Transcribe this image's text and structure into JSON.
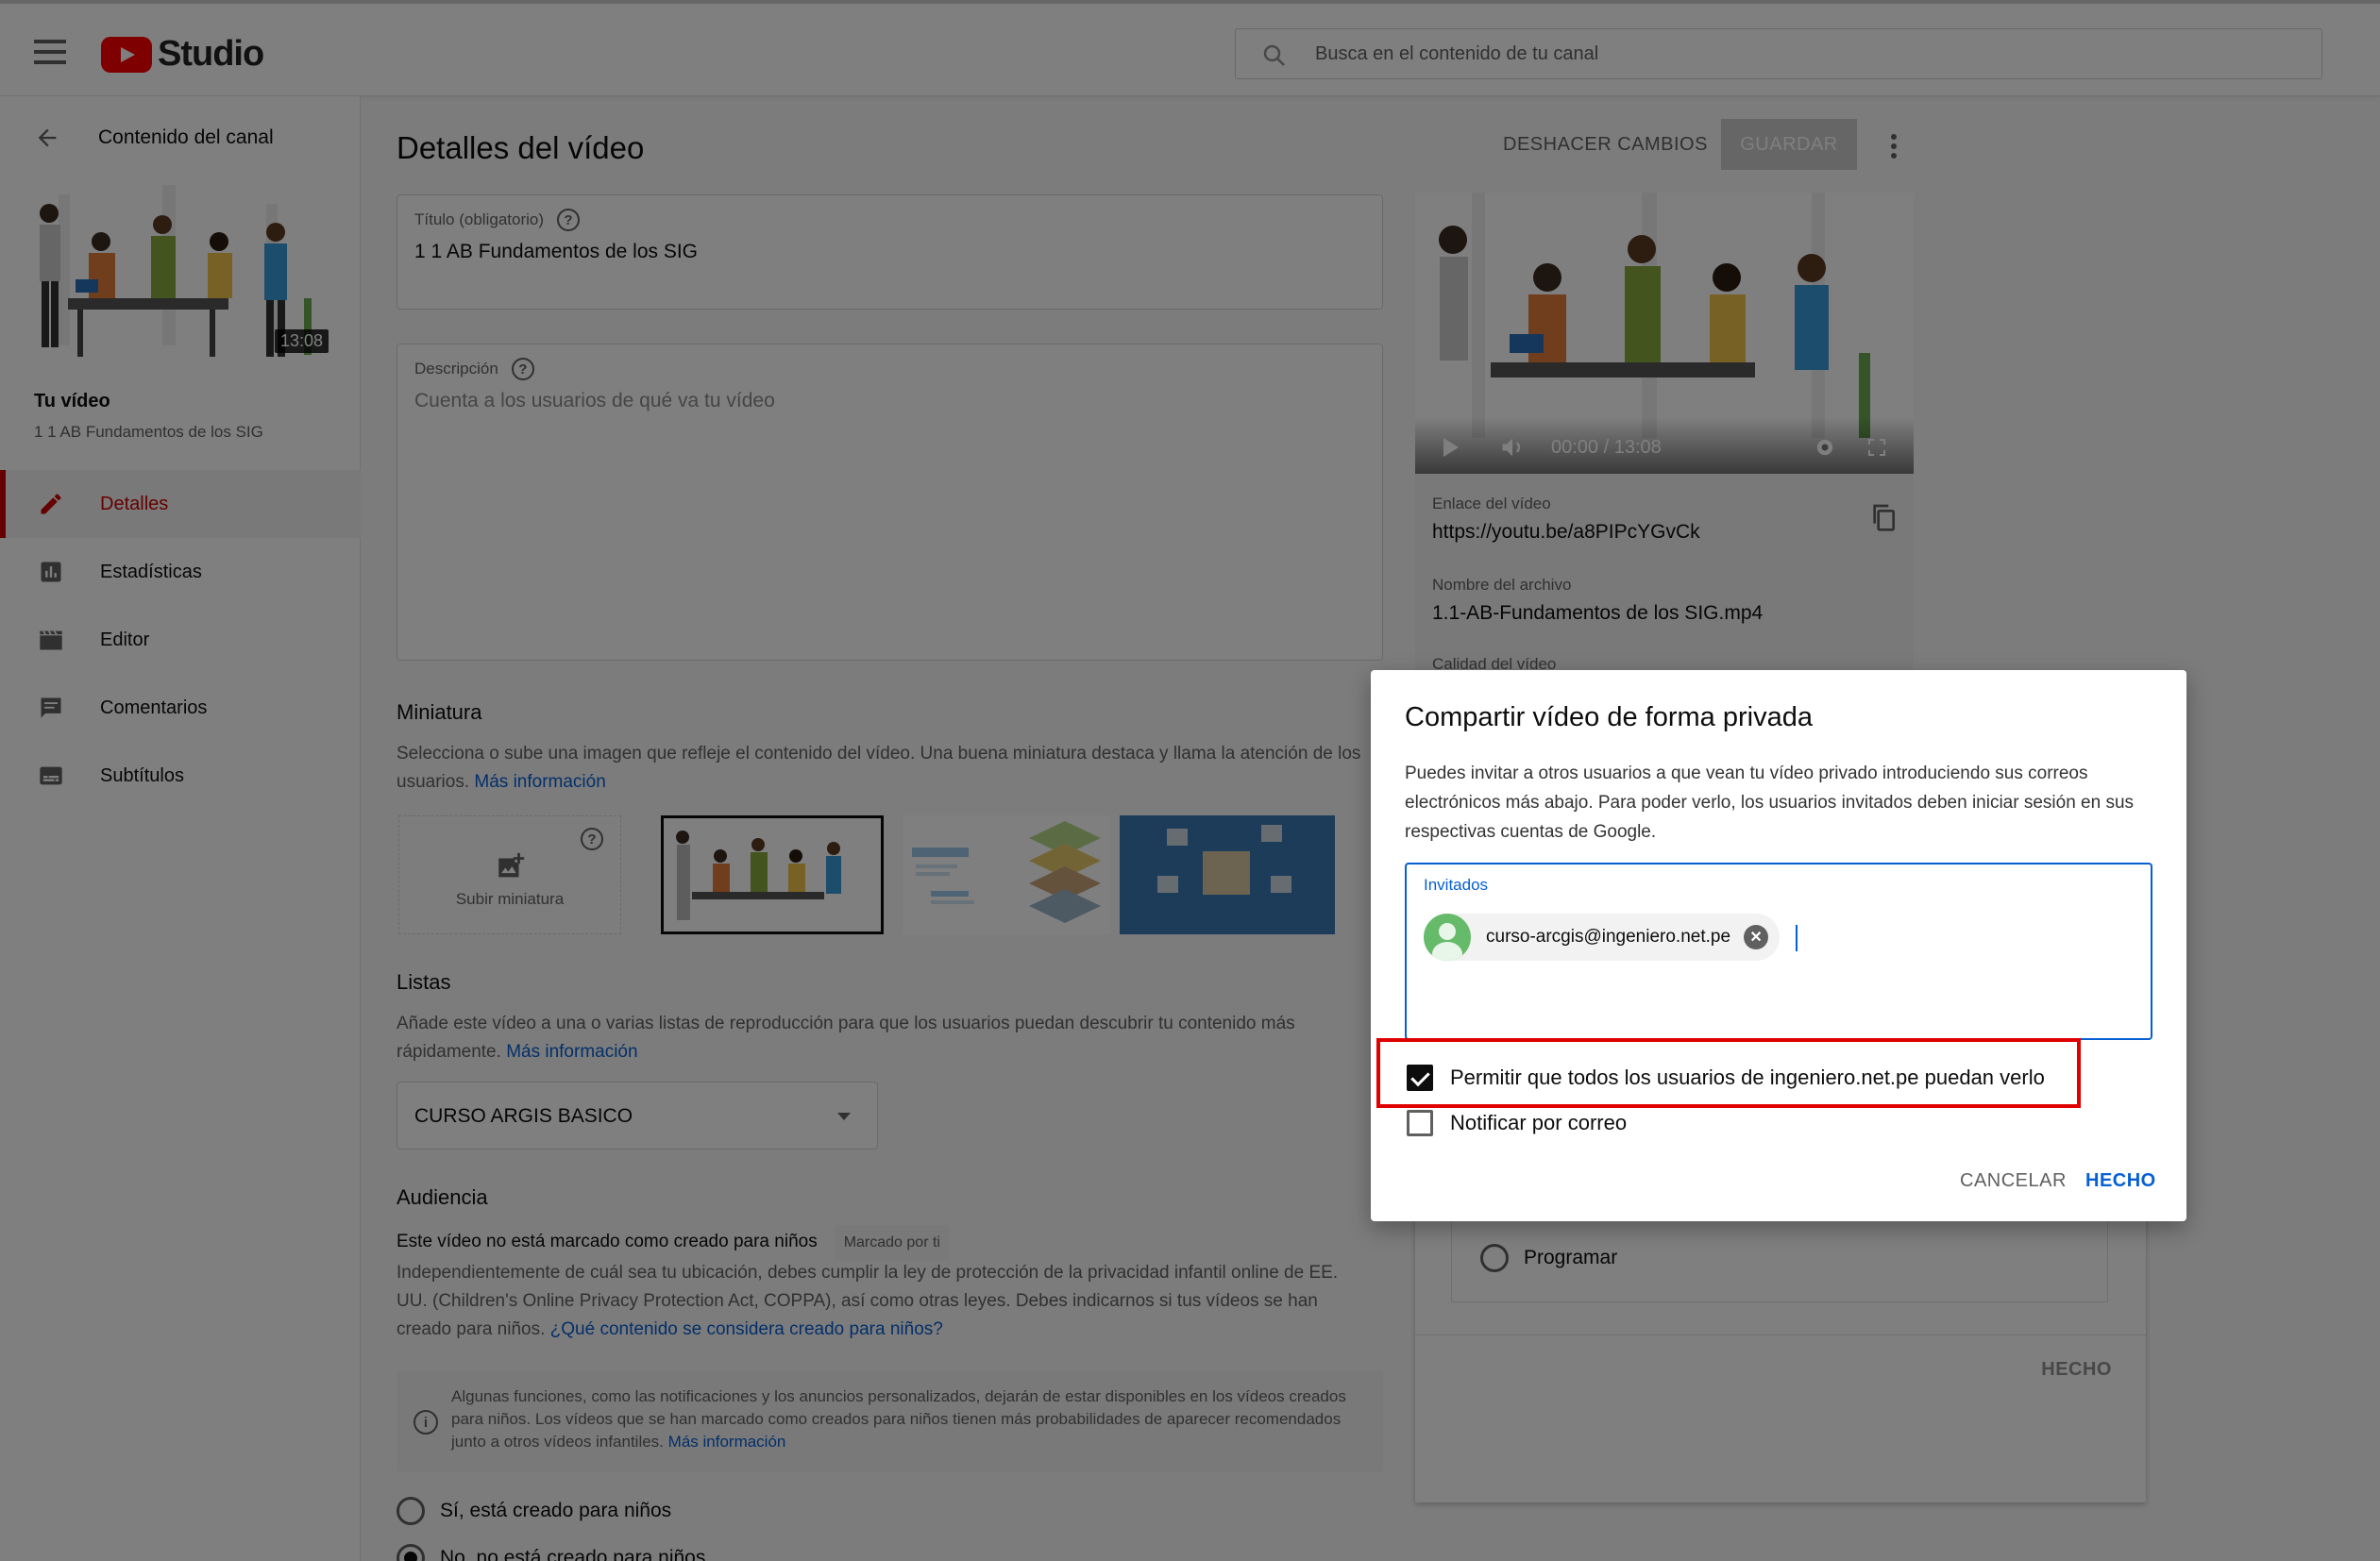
{
  "header": {
    "logo_text": "Studio",
    "search_placeholder": "Busca en el contenido de tu canal"
  },
  "sidebar": {
    "back_label": "Contenido del canal",
    "thumb_duration": "13:08",
    "your_video_label": "Tu vídeo",
    "video_title": "1 1 AB Fundamentos de los SIG",
    "items": [
      {
        "label": "Detalles",
        "icon": "pencil-icon",
        "active": true
      },
      {
        "label": "Estadísticas",
        "icon": "analytics-icon",
        "active": false
      },
      {
        "label": "Editor",
        "icon": "clapperboard-icon",
        "active": false
      },
      {
        "label": "Comentarios",
        "icon": "comment-icon",
        "active": false
      },
      {
        "label": "Subtítulos",
        "icon": "subtitles-icon",
        "active": false
      }
    ]
  },
  "main": {
    "page_title": "Detalles del vídeo",
    "undo_label": "DESHACER CAMBIOS",
    "save_label": "GUARDAR",
    "title_field": {
      "label": "Título (obligatorio)",
      "value": "1 1 AB Fundamentos de los SIG"
    },
    "description_field": {
      "label": "Descripción",
      "placeholder": "Cuenta a los usuarios de qué va tu vídeo"
    },
    "thumbnail": {
      "heading": "Miniatura",
      "text": "Selecciona o sube una imagen que refleje el contenido del vídeo. Una buena miniatura destaca y llama la atención de los",
      "text2": "usuarios.",
      "more_link": "Más información",
      "upload_label": "Subir miniatura"
    },
    "playlists": {
      "heading": "Listas",
      "text": "Añade este vídeo a una o varias listas de reproducción para que los usuarios puedan descubrir tu contenido más",
      "text2": "rápidamente.",
      "more_link": "Más información",
      "selected": "CURSO ARGIS BASICO"
    },
    "audience": {
      "heading": "Audiencia",
      "status": "Este vídeo no está marcado como creado para niños",
      "badge": "Marcado por ti",
      "text1": "Independientemente de cuál sea tu ubicación, debes cumplir la ley de protección de la privacidad infantil online de EE.",
      "text2": "UU. (Children's Online Privacy Protection Act, COPPA), así como otras leyes. Debes indicarnos si tus vídeos se han",
      "text3": "creado para niños.",
      "coppa_link": "¿Qué contenido se considera creado para niños?",
      "info_text": "Algunas funciones, como las notificaciones y los anuncios personalizados, dejarán de estar disponibles en los vídeos creados para niños. Los vídeos que se han marcado como creados para niños tienen más probabilidades de aparecer recomendados junto a otros vídeos infantiles.",
      "info_link": "Más información",
      "option_yes": "Sí, está creado para niños",
      "option_no": "No, no está creado para niños"
    }
  },
  "right_panel": {
    "player_time": "00:00 / 13:08",
    "link_label": "Enlace del vídeo",
    "link_value": "https://youtu.be/a8PIPcYGvCk",
    "file_label": "Nombre del archivo",
    "file_value": "1.1-AB-Fundamentos de los SIG.mp4",
    "quality_label": "Calidad del vídeo"
  },
  "visibility_card": {
    "schedule_label": "Programar",
    "done_label": "HECHO"
  },
  "dialog": {
    "title": "Compartir vídeo de forma privada",
    "description": "Puedes invitar a otros usuarios a que vean tu vídeo privado introduciendo sus correos electrónicos más abajo. Para poder verlo, los usuarios invitados deben iniciar sesión en sus respectivas cuentas de Google.",
    "guests_label": "Invitados",
    "guest_email": "curso-arcgis@ingeniero.net.pe",
    "allow_domain_label": "Permitir que todos los usuarios de ingeniero.net.pe puedan verlo",
    "allow_domain_checked": true,
    "notify_label": "Notificar por correo",
    "notify_checked": false,
    "cancel_label": "CANCELAR",
    "done_label": "HECHO"
  },
  "colors": {
    "accent_red": "#cc0000",
    "link_blue": "#065fd4",
    "highlight_red": "#e00000"
  }
}
